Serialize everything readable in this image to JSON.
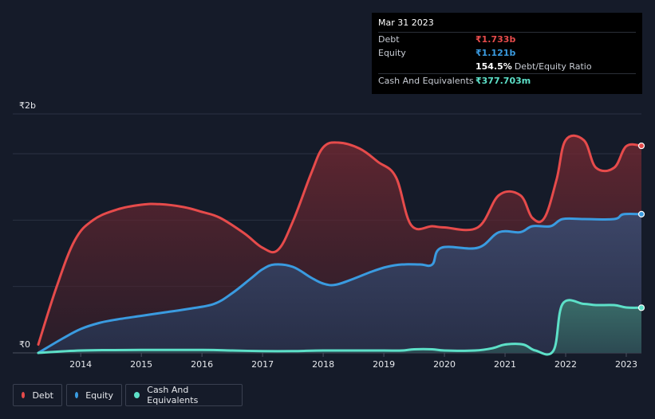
{
  "tooltip": {
    "date": "Mar 31 2023",
    "rows": [
      {
        "label": "Debt",
        "value": "₹1.733b",
        "color": "#e64b4b"
      },
      {
        "label": "Equity",
        "value": "₹1.121b",
        "color": "#3a9be0"
      },
      {
        "label": "",
        "value": "154.5%",
        "suffix": "Debt/Equity Ratio",
        "color": "#ffffff"
      },
      {
        "label": "Cash And Equivalents",
        "value": "₹377.703m",
        "color": "#5de0c8"
      }
    ]
  },
  "legend": [
    {
      "label": "Debt",
      "color": "#e64b4b"
    },
    {
      "label": "Equity",
      "color": "#3a9be0"
    },
    {
      "label": "Cash And Equivalents",
      "color": "#5de0c8"
    }
  ],
  "chart_data": {
    "type": "area",
    "y_tick_labels": [
      "₹0",
      "₹2b"
    ],
    "ylim": [
      0,
      2
    ],
    "xlim": [
      2013.3,
      2023.25
    ],
    "x_tick_labels": [
      "2014",
      "2015",
      "2016",
      "2017",
      "2018",
      "2019",
      "2020",
      "2021",
      "2022",
      "2023"
    ],
    "x_ticks": [
      2014,
      2015,
      2016,
      2017,
      2018,
      2019,
      2020,
      2021,
      2022,
      2023
    ],
    "grid": true,
    "series": [
      {
        "name": "Debt",
        "color": "#e64b4b",
        "x": [
          2013.3,
          2013.6,
          2013.9,
          2014.2,
          2014.6,
          2015.0,
          2015.3,
          2015.7,
          2016.0,
          2016.3,
          2016.7,
          2017.0,
          2017.25,
          2017.5,
          2017.8,
          2018.0,
          2018.25,
          2018.6,
          2018.9,
          2019.2,
          2019.45,
          2019.8,
          2020.0,
          2020.55,
          2020.9,
          2021.25,
          2021.45,
          2021.65,
          2021.85,
          2022.0,
          2022.3,
          2022.5,
          2022.8,
          2023.0,
          2023.25
        ],
        "y": [
          0.07,
          0.55,
          0.94,
          1.11,
          1.2,
          1.24,
          1.245,
          1.22,
          1.18,
          1.13,
          1.0,
          0.88,
          0.86,
          1.1,
          1.5,
          1.72,
          1.76,
          1.71,
          1.6,
          1.47,
          1.07,
          1.06,
          1.05,
          1.05,
          1.32,
          1.32,
          1.13,
          1.13,
          1.45,
          1.78,
          1.78,
          1.55,
          1.55,
          1.73,
          1.733
        ]
      },
      {
        "name": "Equity",
        "color": "#3a9be0",
        "x": [
          2013.3,
          2013.7,
          2014.0,
          2014.3,
          2014.6,
          2015.0,
          2015.4,
          2015.8,
          2016.2,
          2016.5,
          2016.8,
          2017.0,
          2017.2,
          2017.5,
          2017.8,
          2018.0,
          2018.2,
          2018.5,
          2018.8,
          2019.05,
          2019.3,
          2019.6,
          2019.8,
          2019.95,
          2020.55,
          2020.9,
          2021.25,
          2021.45,
          2021.75,
          2021.95,
          2022.3,
          2022.8,
          2022.95,
          2023.25
        ],
        "y": [
          0.0,
          0.12,
          0.2,
          0.25,
          0.28,
          0.31,
          0.34,
          0.37,
          0.41,
          0.5,
          0.62,
          0.7,
          0.74,
          0.72,
          0.63,
          0.58,
          0.57,
          0.62,
          0.68,
          0.72,
          0.74,
          0.74,
          0.74,
          0.88,
          0.88,
          1.01,
          1.01,
          1.06,
          1.06,
          1.12,
          1.12,
          1.12,
          1.16,
          1.161
        ]
      },
      {
        "name": "Cash And Equivalents",
        "color": "#5de0c8",
        "x": [
          2013.3,
          2014.0,
          2015.0,
          2016.0,
          2016.5,
          2017.0,
          2017.5,
          2018.0,
          2018.5,
          2019.0,
          2019.3,
          2019.5,
          2019.8,
          2020.0,
          2020.5,
          2020.8,
          2021.0,
          2021.3,
          2021.5,
          2021.8,
          2021.95,
          2022.3,
          2022.5,
          2022.8,
          2023.0,
          2023.25
        ],
        "y": [
          0.0,
          0.02,
          0.025,
          0.025,
          0.02,
          0.015,
          0.015,
          0.02,
          0.02,
          0.02,
          0.02,
          0.03,
          0.03,
          0.02,
          0.02,
          0.04,
          0.07,
          0.07,
          0.02,
          0.02,
          0.41,
          0.41,
          0.4,
          0.4,
          0.38,
          0.378
        ]
      }
    ]
  }
}
